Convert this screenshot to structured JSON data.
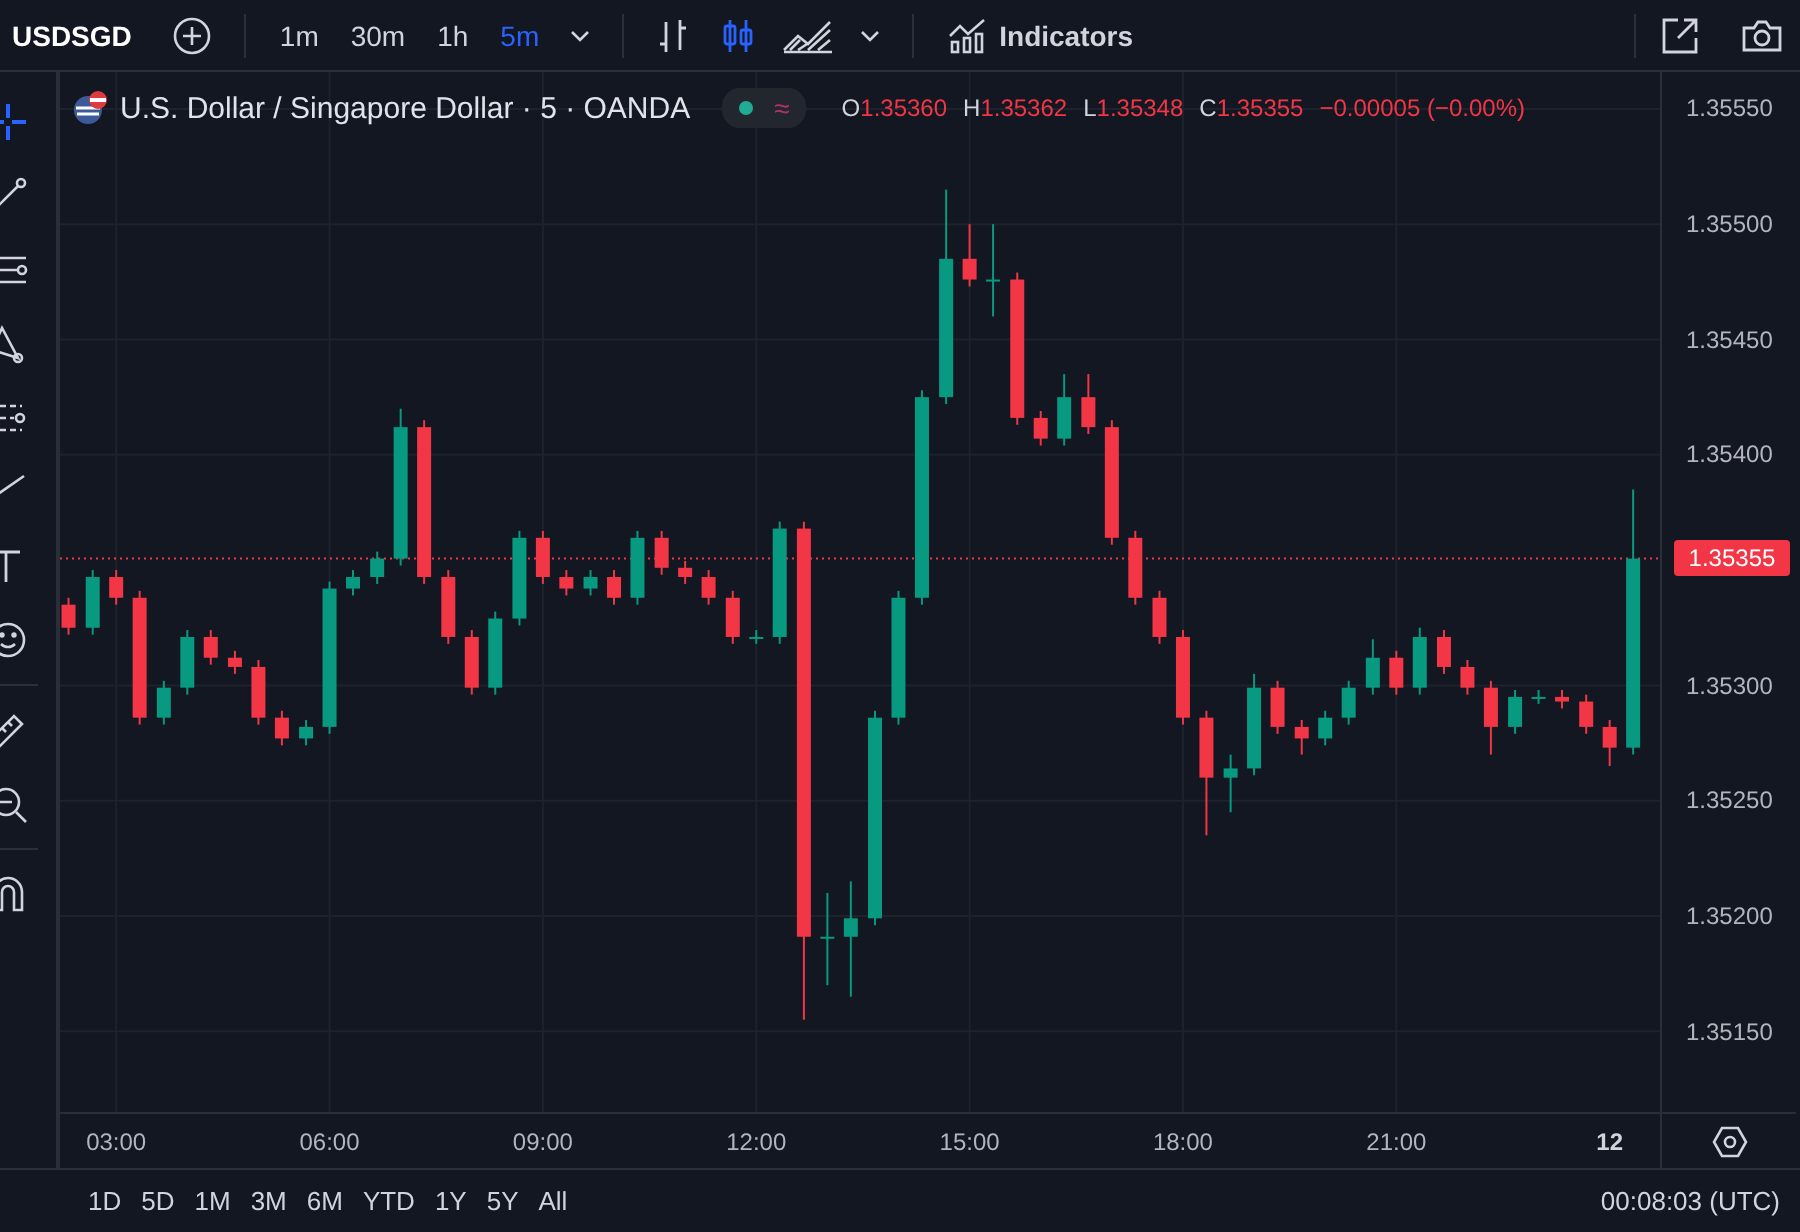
{
  "toolbar": {
    "symbol": "USDSGD",
    "intervals": [
      {
        "label": "1m",
        "selected": false
      },
      {
        "label": "30m",
        "selected": false
      },
      {
        "label": "1h",
        "selected": false
      },
      {
        "label": "5m",
        "selected": true
      }
    ],
    "chart_styles": [
      {
        "kind": "bars",
        "selected": false
      },
      {
        "kind": "candles",
        "selected": true
      },
      {
        "kind": "area",
        "selected": false
      }
    ],
    "indicators_label": "Indicators"
  },
  "legend": {
    "title": "U.S. Dollar / Singapore Dollar · 5 · OANDA",
    "status_glyph": "≈",
    "ohlc": [
      {
        "label": "O",
        "value": "1.35360"
      },
      {
        "label": "H",
        "value": "1.35362"
      },
      {
        "label": "L",
        "value": "1.35348"
      },
      {
        "label": "C",
        "value": "1.35355"
      }
    ],
    "change": "−0.00005 (−0.00%)"
  },
  "chart": {
    "day_label": "12",
    "chart_data": {
      "type": "candlestick",
      "x": [
        2.33,
        2.67,
        3,
        3.33,
        3.67,
        4,
        4.33,
        4.67,
        5,
        5.33,
        5.67,
        6,
        6.33,
        6.67,
        7,
        7.33,
        7.67,
        8,
        8.33,
        8.67,
        9,
        9.33,
        9.67,
        10,
        10.33,
        10.67,
        11,
        11.33,
        11.67,
        12,
        12.33,
        12.67,
        13,
        13.33,
        13.67,
        14,
        14.33,
        14.67,
        15,
        15.33,
        15.67,
        16,
        16.33,
        16.67,
        17,
        17.33,
        17.67,
        18,
        18.33,
        18.67,
        19,
        19.33,
        19.67,
        20,
        20.33,
        20.67,
        21,
        21.33,
        21.67,
        22,
        22.33,
        22.67,
        23,
        23.33,
        23.67,
        24,
        24.33
      ],
      "ohlc": [
        [
          1.35335,
          1.35338,
          1.35322,
          1.35325
        ],
        [
          1.35325,
          1.3535,
          1.35322,
          1.35347
        ],
        [
          1.35347,
          1.3535,
          1.35335,
          1.35338
        ],
        [
          1.35338,
          1.35341,
          1.35283,
          1.35286
        ],
        [
          1.35286,
          1.35302,
          1.35283,
          1.35299
        ],
        [
          1.35299,
          1.35324,
          1.35296,
          1.35321
        ],
        [
          1.35321,
          1.35324,
          1.35309,
          1.35312
        ],
        [
          1.35312,
          1.35315,
          1.35305,
          1.35308
        ],
        [
          1.35308,
          1.35311,
          1.35283,
          1.35286
        ],
        [
          1.35286,
          1.35289,
          1.35274,
          1.35277
        ],
        [
          1.35277,
          1.35285,
          1.35274,
          1.35282
        ],
        [
          1.35282,
          1.35345,
          1.35279,
          1.35342
        ],
        [
          1.35342,
          1.3535,
          1.35339,
          1.35347
        ],
        [
          1.35347,
          1.35358,
          1.35344,
          1.35355
        ],
        [
          1.35355,
          1.3542,
          1.35352,
          1.35412
        ],
        [
          1.35412,
          1.35415,
          1.35344,
          1.35347
        ],
        [
          1.35347,
          1.3535,
          1.35318,
          1.35321
        ],
        [
          1.35321,
          1.35324,
          1.35296,
          1.35299
        ],
        [
          1.35299,
          1.35332,
          1.35296,
          1.35329
        ],
        [
          1.35329,
          1.35367,
          1.35326,
          1.35364
        ],
        [
          1.35364,
          1.35367,
          1.35344,
          1.35347
        ],
        [
          1.35347,
          1.3535,
          1.35339,
          1.35342
        ],
        [
          1.35342,
          1.3535,
          1.35339,
          1.35347
        ],
        [
          1.35347,
          1.3535,
          1.35335,
          1.35338
        ],
        [
          1.35338,
          1.35367,
          1.35335,
          1.35364
        ],
        [
          1.35364,
          1.35367,
          1.35348,
          1.35351
        ],
        [
          1.35351,
          1.35354,
          1.35344,
          1.35347
        ],
        [
          1.35347,
          1.3535,
          1.35335,
          1.35338
        ],
        [
          1.35338,
          1.35341,
          1.35318,
          1.35321
        ],
        [
          1.35321,
          1.35324,
          1.35318,
          1.35321
        ],
        [
          1.35321,
          1.35371,
          1.35318,
          1.35368
        ],
        [
          1.35368,
          1.35371,
          1.35155,
          1.35191
        ],
        [
          1.35191,
          1.3521,
          1.3517,
          1.35191
        ],
        [
          1.35191,
          1.35215,
          1.35165,
          1.35199
        ],
        [
          1.35199,
          1.35289,
          1.35196,
          1.35286
        ],
        [
          1.35286,
          1.35341,
          1.35283,
          1.35338
        ],
        [
          1.35338,
          1.35428,
          1.35335,
          1.35425
        ],
        [
          1.35425,
          1.35515,
          1.35422,
          1.35485
        ],
        [
          1.35485,
          1.355,
          1.35473,
          1.35476
        ],
        [
          1.35476,
          1.355,
          1.3546,
          1.35476
        ],
        [
          1.35476,
          1.35479,
          1.35413,
          1.35416
        ],
        [
          1.35416,
          1.35419,
          1.35404,
          1.35407
        ],
        [
          1.35407,
          1.35435,
          1.35404,
          1.35425
        ],
        [
          1.35425,
          1.35435,
          1.35409,
          1.35412
        ],
        [
          1.35412,
          1.35415,
          1.35361,
          1.35364
        ],
        [
          1.35364,
          1.35367,
          1.35335,
          1.35338
        ],
        [
          1.35338,
          1.35341,
          1.35318,
          1.35321
        ],
        [
          1.35321,
          1.35324,
          1.35283,
          1.35286
        ],
        [
          1.35286,
          1.35289,
          1.35235,
          1.3526
        ],
        [
          1.3526,
          1.3527,
          1.35245,
          1.35264
        ],
        [
          1.35264,
          1.35305,
          1.35261,
          1.35299
        ],
        [
          1.35299,
          1.35302,
          1.35279,
          1.35282
        ],
        [
          1.35282,
          1.35285,
          1.3527,
          1.35277
        ],
        [
          1.35277,
          1.35289,
          1.35274,
          1.35286
        ],
        [
          1.35286,
          1.35302,
          1.35283,
          1.35299
        ],
        [
          1.35299,
          1.3532,
          1.35296,
          1.35312
        ],
        [
          1.35312,
          1.35315,
          1.35296,
          1.35299
        ],
        [
          1.35299,
          1.35325,
          1.35296,
          1.35321
        ],
        [
          1.35321,
          1.35324,
          1.35305,
          1.35308
        ],
        [
          1.35308,
          1.35311,
          1.35296,
          1.35299
        ],
        [
          1.35299,
          1.35302,
          1.3527,
          1.35282
        ],
        [
          1.35282,
          1.35298,
          1.35279,
          1.35295
        ],
        [
          1.35295,
          1.35298,
          1.35292,
          1.35295
        ],
        [
          1.35295,
          1.35298,
          1.3529,
          1.35293
        ],
        [
          1.35293,
          1.35296,
          1.35279,
          1.35282
        ],
        [
          1.35282,
          1.35285,
          1.35265,
          1.35273
        ],
        [
          1.35273,
          1.35385,
          1.3527,
          1.35355
        ]
      ],
      "grid": true,
      "ref_lines": [
        {
          "axis": "y",
          "value": 1.35355,
          "label": "1.35355",
          "color": "#f23645"
        }
      ],
      "xlim": [
        2.21,
        26.62
      ],
      "ylim": [
        1.35115,
        1.35566
      ],
      "xticks": [
        {
          "value": 3,
          "label": "03:00"
        },
        {
          "value": 6,
          "label": "06:00"
        },
        {
          "value": 9,
          "label": "09:00"
        },
        {
          "value": 12,
          "label": "12:00"
        },
        {
          "value": 15,
          "label": "15:00"
        },
        {
          "value": 18,
          "label": "18:00"
        },
        {
          "value": 21,
          "label": "21:00"
        }
      ],
      "yticks": [
        {
          "value": 1.3515,
          "label": "1.35150"
        },
        {
          "value": 1.352,
          "label": "1.35200"
        },
        {
          "value": 1.3525,
          "label": "1.35250"
        },
        {
          "value": 1.353,
          "label": "1.35300"
        },
        {
          "value": 1.354,
          "label": "1.35400"
        },
        {
          "value": 1.3545,
          "label": "1.35450"
        },
        {
          "value": 1.355,
          "label": "1.35500"
        },
        {
          "value": 1.3555,
          "label": "1.35550"
        }
      ]
    }
  },
  "bottom_bar": {
    "ranges": [
      "1D",
      "5D",
      "1M",
      "3M",
      "6M",
      "YTD",
      "1Y",
      "5Y",
      "All"
    ],
    "clock": "00:08:03 (UTC)"
  }
}
